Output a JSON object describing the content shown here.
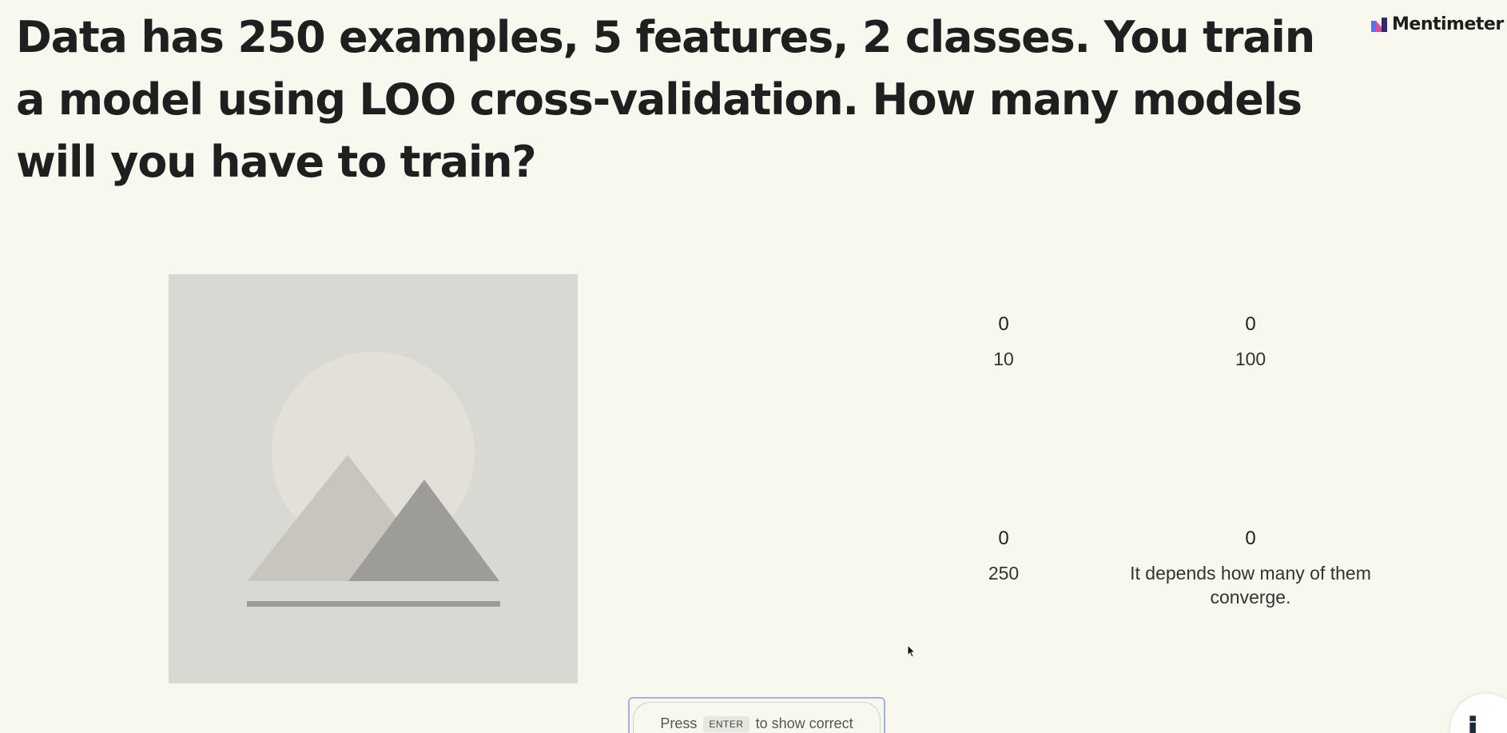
{
  "question": "Data has 250 examples, 5 features, 2 classes. You train a model using LOO cross-validation. How many models will you have to train?",
  "brand": {
    "name": "Mentimeter",
    "logo_colors": [
      "#5a6ef4",
      "#e8479a",
      "#2b2b6e"
    ]
  },
  "image": {
    "type": "image-placeholder",
    "colors": {
      "background": "#d9d9d4",
      "sun": "#e3e0d7",
      "mountain_back": "#c8c5bd",
      "mountain_front": "#9d9c98",
      "ground": "#9d9c98"
    }
  },
  "options": [
    {
      "count": "0",
      "label": "10"
    },
    {
      "count": "0",
      "label": "100"
    },
    {
      "count": "0",
      "label": "250"
    },
    {
      "count": "0",
      "label": "It depends how many of them converge."
    }
  ],
  "hint": {
    "prefix": "Press",
    "key": "ENTER",
    "suffix": "to show correct"
  },
  "accent_colors": {
    "background": "#f9f8ef",
    "hint_border": "#9fb3dc"
  }
}
